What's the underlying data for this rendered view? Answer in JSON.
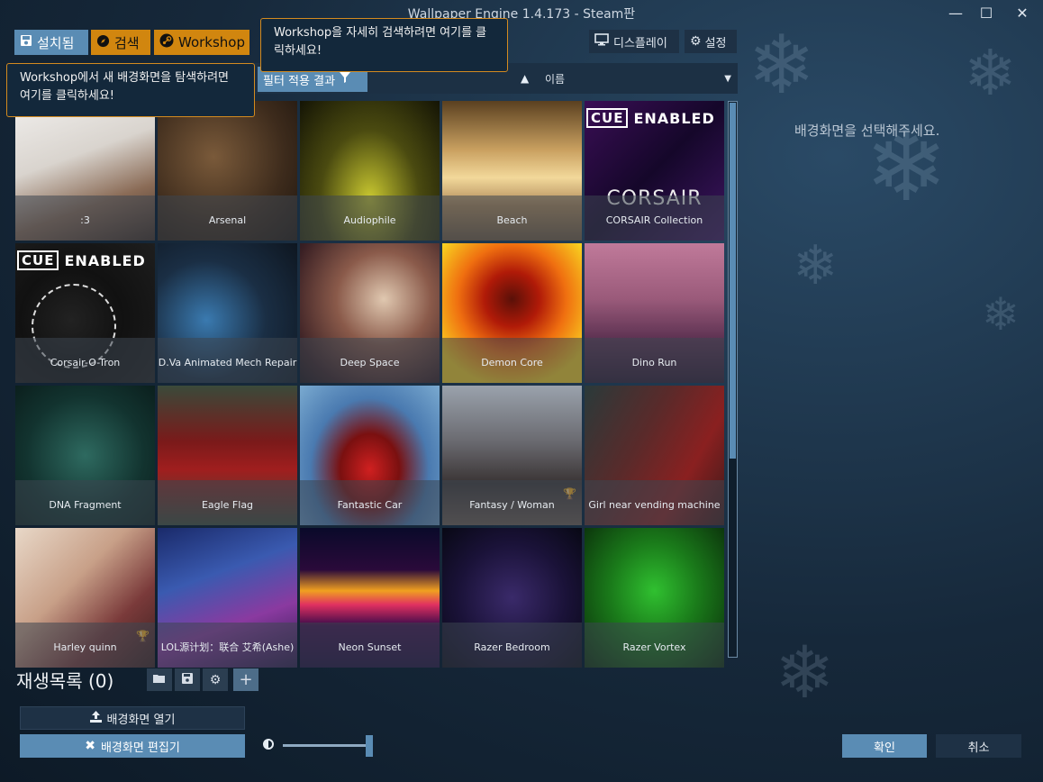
{
  "window": {
    "title": "Wallpaper Engine 1.4.173 - Steam판",
    "minimize_glyph": "—",
    "maximize_glyph": "☐",
    "close_glyph": "✕"
  },
  "tabs": {
    "installed": "설치됨",
    "search": "검색",
    "workshop": "Workshop"
  },
  "topbar": {
    "display": "디스플레이",
    "settings": "설정"
  },
  "tooltips": {
    "workshop_search": "Workshop을 자세히 검색하려면 여기를 클릭하세요!",
    "workshop_browse": "Workshop에서 새 배경화면을 탐색하려면 여기를 클릭하세요!"
  },
  "filter": {
    "result_label": "필터 적용 결과",
    "sort_value": "이름"
  },
  "wallpapers": [
    {
      "name": ":3"
    },
    {
      "name": "Arsenal"
    },
    {
      "name": "Audiophile"
    },
    {
      "name": "Beach"
    },
    {
      "name": "CORSAIR Collection"
    },
    {
      "name": "Corsair-O-Tron"
    },
    {
      "name": "D.Va Animated Mech Repair"
    },
    {
      "name": "Deep Space"
    },
    {
      "name": "Demon Core"
    },
    {
      "name": "Dino Run"
    },
    {
      "name": "DNA Fragment"
    },
    {
      "name": "Eagle Flag"
    },
    {
      "name": "Fantastic Car"
    },
    {
      "name": "Fantasy / Woman"
    },
    {
      "name": "Girl near vending machine"
    },
    {
      "name": "Harley quinn"
    },
    {
      "name": "LOL源计划：联合 艾希(Ashe)"
    },
    {
      "name": "Neon Sunset"
    },
    {
      "name": "Razer Bedroom"
    },
    {
      "name": "Razer Vortex"
    }
  ],
  "cue_badge": {
    "box": "CUE",
    "text": "ENABLED",
    "corsair_word": "CORSAIR"
  },
  "colors": {
    "accent_blue": "#5a8cb4",
    "accent_orange": "#d1860f",
    "panel_dark": "#1e3145"
  },
  "right_panel": {
    "message": "배경화면을 선택해주세요."
  },
  "playlist": {
    "title": "재생목록 (0)"
  },
  "buttons": {
    "open_wallpaper": "배경화면 열기",
    "wallpaper_editor": "배경화면 편집기",
    "ok": "확인",
    "cancel": "취소"
  },
  "brightness": {
    "value_fraction": 1.0
  }
}
